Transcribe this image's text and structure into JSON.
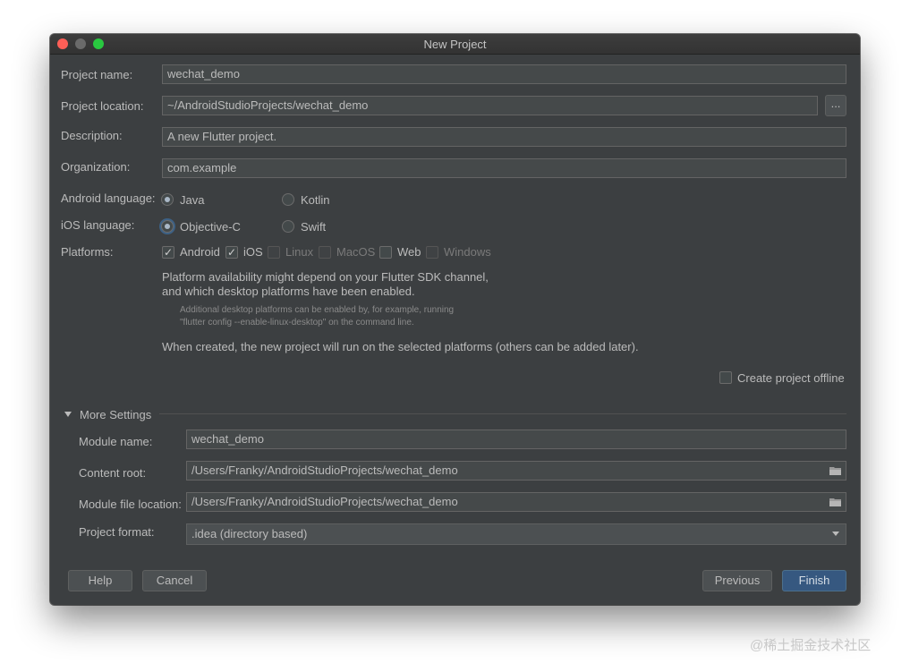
{
  "window": {
    "title": "New Project"
  },
  "project": {
    "name_label": "Project name:",
    "name_value": "wechat_demo",
    "location_label": "Project location:",
    "location_value": "~/AndroidStudioProjects/wechat_demo",
    "browse_label": "...",
    "description_label": "Description:",
    "description_value": "A new Flutter project.",
    "organization_label": "Organization:",
    "organization_value": "com.example"
  },
  "android_language": {
    "label": "Android language:",
    "options": [
      "Java",
      "Kotlin"
    ],
    "selected": "Java"
  },
  "ios_language": {
    "label": "iOS language:",
    "options": [
      "Objective-C",
      "Swift"
    ],
    "selected": "Objective-C"
  },
  "platforms": {
    "label": "Platforms:",
    "items": [
      {
        "label": "Android",
        "checked": true,
        "enabled": true
      },
      {
        "label": "iOS",
        "checked": true,
        "enabled": true
      },
      {
        "label": "Linux",
        "checked": false,
        "enabled": false
      },
      {
        "label": "MacOS",
        "checked": false,
        "enabled": false
      },
      {
        "label": "Web",
        "checked": false,
        "enabled": true
      },
      {
        "label": "Windows",
        "checked": false,
        "enabled": false
      }
    ],
    "note_line1": "Platform availability might depend on your Flutter SDK channel,",
    "note_line2": "and which desktop platforms have been enabled.",
    "hint_line1": "Additional desktop platforms can be enabled by, for example, running",
    "hint_line2": "\"flutter config --enable-linux-desktop\" on the command line.",
    "created_note": "When created, the new project will run on the selected platforms (others can be added later)."
  },
  "offline": {
    "label": "Create project offline",
    "checked": false
  },
  "more_settings": {
    "title": "More Settings",
    "module_name_label": "Module name:",
    "module_name_value": "wechat_demo",
    "content_root_label": "Content root:",
    "content_root_value": "/Users/Franky/AndroidStudioProjects/wechat_demo",
    "module_file_label": "Module file location:",
    "module_file_value": "/Users/Franky/AndroidStudioProjects/wechat_demo",
    "project_format_label": "Project format:",
    "project_format_value": ".idea (directory based)"
  },
  "buttons": {
    "help": "Help",
    "cancel": "Cancel",
    "previous": "Previous",
    "finish": "Finish"
  },
  "watermark": "@稀土掘金技术社区",
  "colors": {
    "background": "#3c3f41",
    "field": "#45494a",
    "primary_button": "#365880",
    "focus": "#3d6185"
  }
}
